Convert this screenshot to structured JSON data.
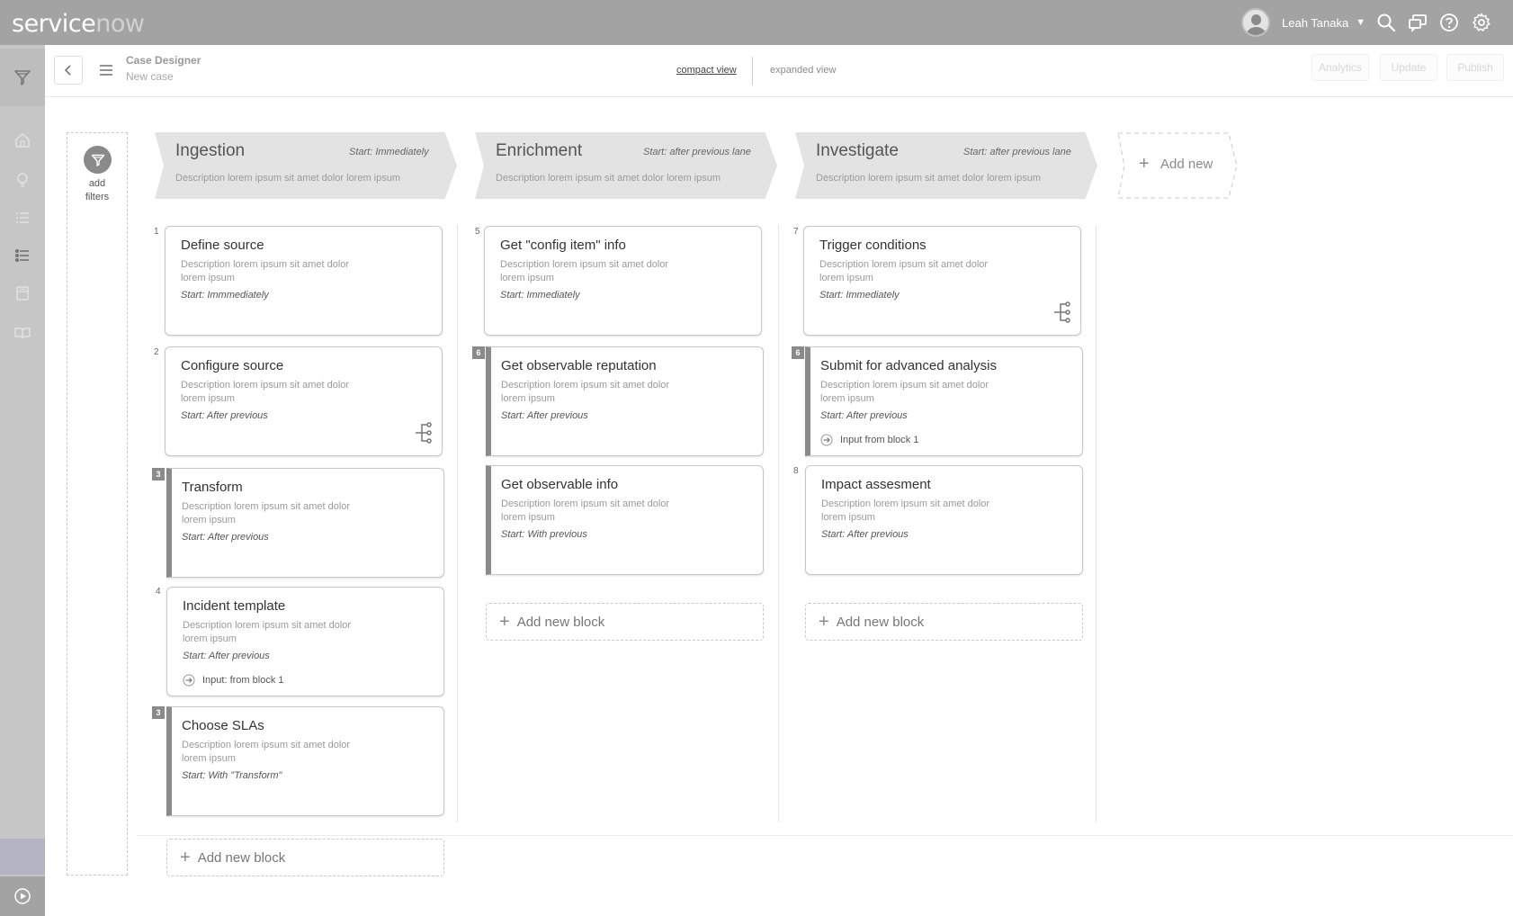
{
  "app": {
    "logo": {
      "service": "service",
      "now": "now"
    },
    "user": {
      "name": "Leah Tanaka",
      "caret": "▼"
    }
  },
  "header": {
    "title": "Case Designer",
    "subtitle": "New case",
    "views": {
      "compact": "compact view",
      "expanded": "expanded view"
    },
    "buttons": {
      "analytics": "Analytics",
      "update": "Update",
      "publish": "Publish"
    }
  },
  "filters": {
    "label_line1": "add",
    "label_line2": "filters"
  },
  "lanes": [
    {
      "title": "Ingestion",
      "start": "Start: Immediately",
      "description": "Description lorem ipsum sit amet dolor lorem ipsum"
    },
    {
      "title": "Enrichment",
      "start": "Start: after previous lane",
      "description": "Description lorem ipsum sit amet dolor lorem ipsum"
    },
    {
      "title": "Investigate",
      "start": "Start: after previous lane",
      "description": "Description lorem ipsum sit amet dolor lorem ipsum"
    }
  ],
  "add_new_lane": "Add new",
  "cards": [
    {
      "num": "1",
      "title": "Define source",
      "description": "Description lorem ipsum sit amet dolor lorem ipsum",
      "start": "Start: Immmediately"
    },
    {
      "num": "2",
      "title": "Configure source",
      "description": "Description lorem ipsum sit amet dolor lorem ipsum",
      "start": "Start: After previous"
    },
    {
      "num": "3",
      "title": "Transform",
      "description": "Description lorem ipsum sit amet dolor lorem ipsum",
      "start": "Start: After previous"
    },
    {
      "num": "4",
      "title": "Incident template",
      "description": "Description lorem ipsum sit amet dolor lorem ipsum",
      "start": "Start: After previous",
      "input": "Input: from block 1"
    },
    {
      "num": "3",
      "title": "Choose SLAs",
      "description": "Description lorem ipsum sit amet dolor lorem ipsum",
      "start": "Start: With \"Transform\""
    },
    {
      "num": "5",
      "title": "Get \"config item\" info",
      "description": "Description lorem ipsum sit amet dolor lorem ipsum",
      "start": "Start: Immediately"
    },
    {
      "num": "6",
      "title": "Get observable reputation",
      "description": "Description lorem ipsum sit amet dolor lorem ipsum",
      "start": "Start: After previous"
    },
    {
      "title": "Get observable info",
      "description": "Description lorem ipsum sit amet dolor lorem ipsum",
      "start": "Start: With previous"
    },
    {
      "num": "7",
      "title": "Trigger conditions",
      "description": "Description lorem ipsum sit amet dolor lorem ipsum",
      "start": "Start: Immediately"
    },
    {
      "num": "6",
      "title": "Submit for advanced analysis",
      "description": "Description lorem ipsum sit amet dolor lorem ipsum",
      "start": "Start: After previous",
      "input": "Input from block 1"
    },
    {
      "num": "8",
      "title": "Impact assesment",
      "description": "Description lorem ipsum sit amet dolor lorem ipsum",
      "start": "Start: After previous"
    }
  ],
  "add_block": {
    "label": "Add new block",
    "plus": "+"
  },
  "icons": {
    "topbar": [
      "search-icon",
      "chat-icon",
      "help-icon",
      "gear-icon"
    ],
    "rail": [
      "filter-icon",
      "home-icon",
      "lightbulb-icon",
      "list-icon",
      "list-active-icon",
      "archive-icon",
      "book-icon",
      "play-icon"
    ],
    "card": [
      "branch-icon",
      "input-arrow-icon"
    ]
  },
  "colors": {
    "topbar": "#a3a3a3",
    "rail": "#c6c6c6",
    "lane_header": "#e3e3e3",
    "block_bar": "#8a8a8a"
  }
}
